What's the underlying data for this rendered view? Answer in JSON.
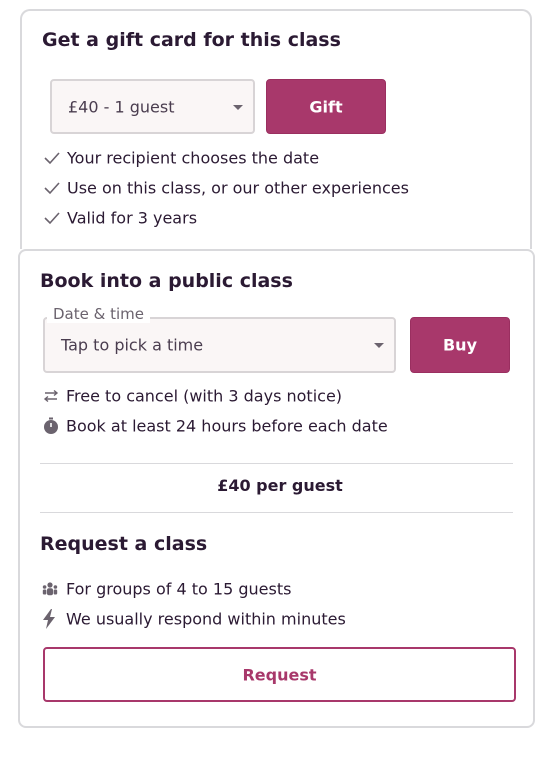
{
  "gift": {
    "title": "Get a gift card for this class",
    "select_value": "£40 - 1 guest",
    "button_label": "Gift",
    "features": [
      {
        "icon": "check-icon",
        "text": "Your recipient chooses the date"
      },
      {
        "icon": "check-icon",
        "text": "Use on this class, or our other experiences"
      },
      {
        "icon": "check-icon",
        "text": "Valid for 3 years"
      }
    ]
  },
  "public_class": {
    "title": "Book into a public class",
    "date_label": "Date & time",
    "date_placeholder": "Tap to pick a time",
    "button_label": "Buy",
    "features": [
      {
        "icon": "swap-arrows-icon",
        "text": "Free to cancel (with 3 days notice)"
      },
      {
        "icon": "stopwatch-icon",
        "text": "Book at least 24 hours before each date"
      }
    ],
    "price": "£40 per guest"
  },
  "request": {
    "title": "Request a class",
    "features": [
      {
        "icon": "group-icon",
        "text": "For groups of 4 to 15 guests"
      },
      {
        "icon": "lightning-icon",
        "text": "We usually respond within minutes"
      }
    ],
    "button_label": "Request"
  },
  "colors": {
    "brand": "#a8386b",
    "text": "#2b1a33",
    "border": "#d9d9dc",
    "select_bg": "#faf6f6"
  }
}
